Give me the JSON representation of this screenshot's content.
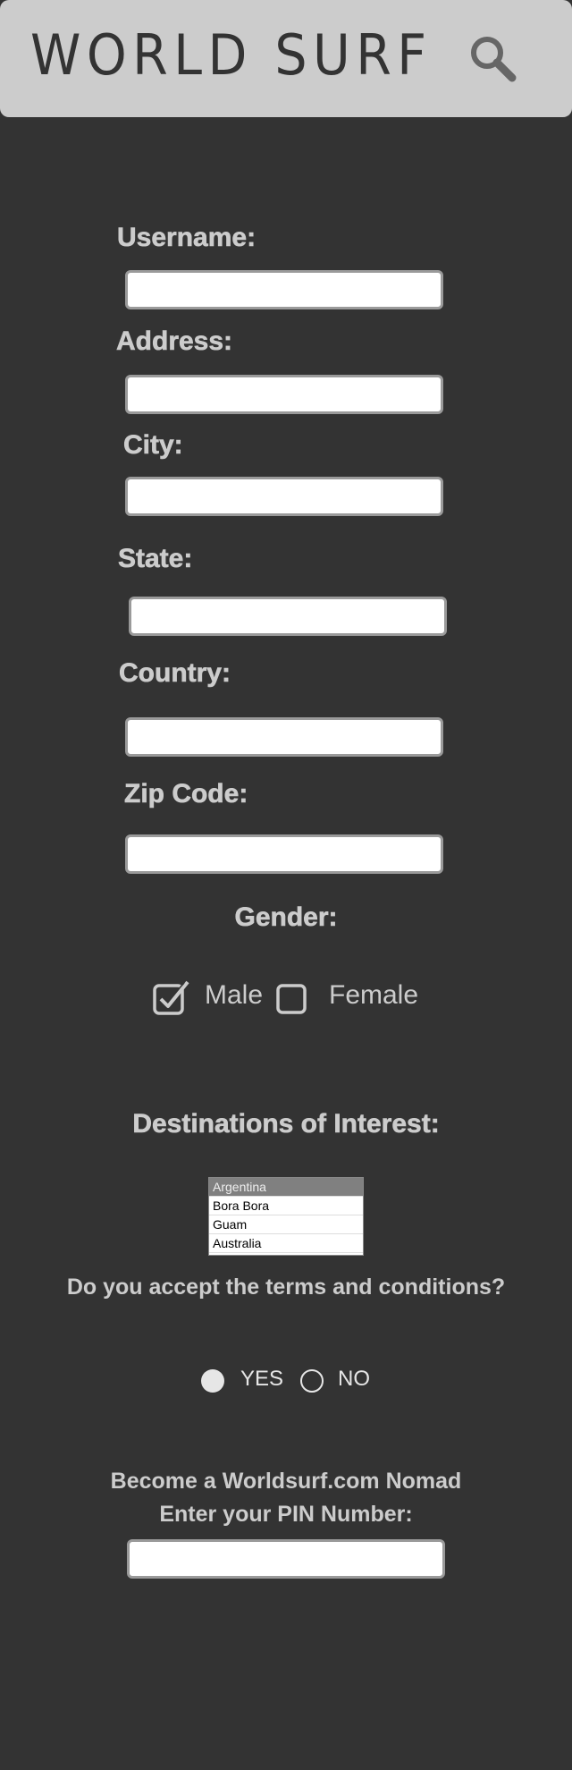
{
  "header": {
    "brand": "WORLD SURF",
    "search_icon": "search-icon"
  },
  "form": {
    "username_label": "Username:",
    "address_label": "Address:",
    "city_label": "City:",
    "state_label": "State:",
    "country_label": "Country:",
    "zip_label": "Zip Code:",
    "username_value": "",
    "address_value": "",
    "city_value": "",
    "state_value": "",
    "country_value": "",
    "zip_value": ""
  },
  "gender": {
    "label": "Gender:",
    "male_label": "Male",
    "female_label": "Female",
    "male_checked": true,
    "female_checked": false
  },
  "destinations": {
    "label": "Destinations of Interest:",
    "options": [
      "Argentina",
      "Bora Bora",
      "Guam",
      "Australia"
    ],
    "selected": "Argentina"
  },
  "terms": {
    "question": "Do you accept the terms and conditions?",
    "yes_label": "YES",
    "no_label": "NO",
    "selected": "YES"
  },
  "nomad": {
    "line1": "Become a Worldsurf.com Nomad",
    "line2": "Enter your PIN Number:",
    "pin_value": ""
  },
  "colors": {
    "background": "#333333",
    "header": "#cccccc",
    "label": "#cccccc"
  }
}
